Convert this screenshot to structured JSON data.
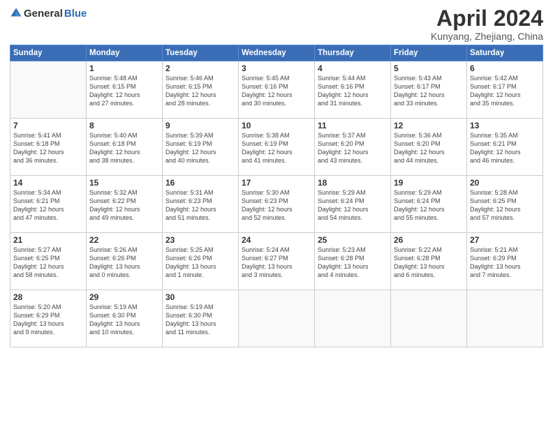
{
  "logo": {
    "general": "General",
    "blue": "Blue"
  },
  "title": "April 2024",
  "location": "Kunyang, Zhejiang, China",
  "headers": [
    "Sunday",
    "Monday",
    "Tuesday",
    "Wednesday",
    "Thursday",
    "Friday",
    "Saturday"
  ],
  "weeks": [
    [
      {
        "day": "",
        "info": ""
      },
      {
        "day": "1",
        "info": "Sunrise: 5:48 AM\nSunset: 6:15 PM\nDaylight: 12 hours\nand 27 minutes."
      },
      {
        "day": "2",
        "info": "Sunrise: 5:46 AM\nSunset: 6:15 PM\nDaylight: 12 hours\nand 28 minutes."
      },
      {
        "day": "3",
        "info": "Sunrise: 5:45 AM\nSunset: 6:16 PM\nDaylight: 12 hours\nand 30 minutes."
      },
      {
        "day": "4",
        "info": "Sunrise: 5:44 AM\nSunset: 6:16 PM\nDaylight: 12 hours\nand 31 minutes."
      },
      {
        "day": "5",
        "info": "Sunrise: 5:43 AM\nSunset: 6:17 PM\nDaylight: 12 hours\nand 33 minutes."
      },
      {
        "day": "6",
        "info": "Sunrise: 5:42 AM\nSunset: 6:17 PM\nDaylight: 12 hours\nand 35 minutes."
      }
    ],
    [
      {
        "day": "7",
        "info": "Sunrise: 5:41 AM\nSunset: 6:18 PM\nDaylight: 12 hours\nand 36 minutes."
      },
      {
        "day": "8",
        "info": "Sunrise: 5:40 AM\nSunset: 6:18 PM\nDaylight: 12 hours\nand 38 minutes."
      },
      {
        "day": "9",
        "info": "Sunrise: 5:39 AM\nSunset: 6:19 PM\nDaylight: 12 hours\nand 40 minutes."
      },
      {
        "day": "10",
        "info": "Sunrise: 5:38 AM\nSunset: 6:19 PM\nDaylight: 12 hours\nand 41 minutes."
      },
      {
        "day": "11",
        "info": "Sunrise: 5:37 AM\nSunset: 6:20 PM\nDaylight: 12 hours\nand 43 minutes."
      },
      {
        "day": "12",
        "info": "Sunrise: 5:36 AM\nSunset: 6:20 PM\nDaylight: 12 hours\nand 44 minutes."
      },
      {
        "day": "13",
        "info": "Sunrise: 5:35 AM\nSunset: 6:21 PM\nDaylight: 12 hours\nand 46 minutes."
      }
    ],
    [
      {
        "day": "14",
        "info": "Sunrise: 5:34 AM\nSunset: 6:21 PM\nDaylight: 12 hours\nand 47 minutes."
      },
      {
        "day": "15",
        "info": "Sunrise: 5:32 AM\nSunset: 6:22 PM\nDaylight: 12 hours\nand 49 minutes."
      },
      {
        "day": "16",
        "info": "Sunrise: 5:31 AM\nSunset: 6:23 PM\nDaylight: 12 hours\nand 51 minutes."
      },
      {
        "day": "17",
        "info": "Sunrise: 5:30 AM\nSunset: 6:23 PM\nDaylight: 12 hours\nand 52 minutes."
      },
      {
        "day": "18",
        "info": "Sunrise: 5:29 AM\nSunset: 6:24 PM\nDaylight: 12 hours\nand 54 minutes."
      },
      {
        "day": "19",
        "info": "Sunrise: 5:29 AM\nSunset: 6:24 PM\nDaylight: 12 hours\nand 55 minutes."
      },
      {
        "day": "20",
        "info": "Sunrise: 5:28 AM\nSunset: 6:25 PM\nDaylight: 12 hours\nand 57 minutes."
      }
    ],
    [
      {
        "day": "21",
        "info": "Sunrise: 5:27 AM\nSunset: 6:25 PM\nDaylight: 12 hours\nand 58 minutes."
      },
      {
        "day": "22",
        "info": "Sunrise: 5:26 AM\nSunset: 6:26 PM\nDaylight: 13 hours\nand 0 minutes."
      },
      {
        "day": "23",
        "info": "Sunrise: 5:25 AM\nSunset: 6:26 PM\nDaylight: 13 hours\nand 1 minute."
      },
      {
        "day": "24",
        "info": "Sunrise: 5:24 AM\nSunset: 6:27 PM\nDaylight: 13 hours\nand 3 minutes."
      },
      {
        "day": "25",
        "info": "Sunrise: 5:23 AM\nSunset: 6:28 PM\nDaylight: 13 hours\nand 4 minutes."
      },
      {
        "day": "26",
        "info": "Sunrise: 5:22 AM\nSunset: 6:28 PM\nDaylight: 13 hours\nand 6 minutes."
      },
      {
        "day": "27",
        "info": "Sunrise: 5:21 AM\nSunset: 6:29 PM\nDaylight: 13 hours\nand 7 minutes."
      }
    ],
    [
      {
        "day": "28",
        "info": "Sunrise: 5:20 AM\nSunset: 6:29 PM\nDaylight: 13 hours\nand 9 minutes."
      },
      {
        "day": "29",
        "info": "Sunrise: 5:19 AM\nSunset: 6:30 PM\nDaylight: 13 hours\nand 10 minutes."
      },
      {
        "day": "30",
        "info": "Sunrise: 5:19 AM\nSunset: 6:30 PM\nDaylight: 13 hours\nand 11 minutes."
      },
      {
        "day": "",
        "info": ""
      },
      {
        "day": "",
        "info": ""
      },
      {
        "day": "",
        "info": ""
      },
      {
        "day": "",
        "info": ""
      }
    ]
  ]
}
